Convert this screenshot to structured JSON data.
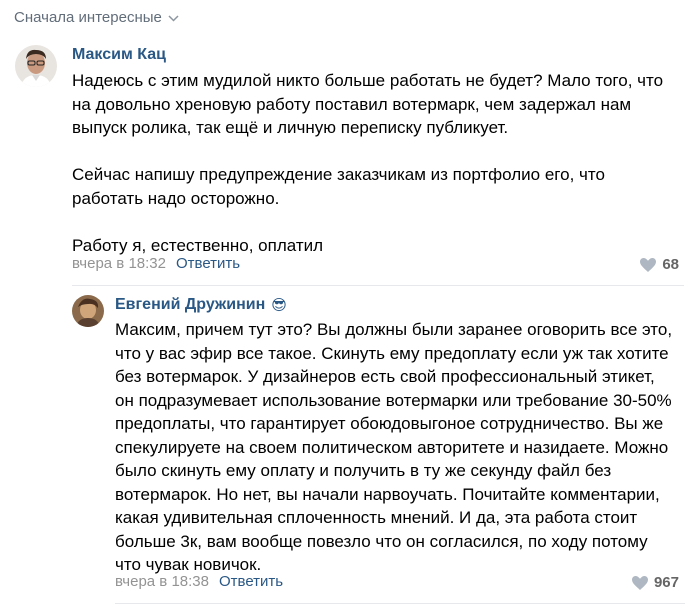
{
  "sort": {
    "label": "Сначала интересные"
  },
  "comments": [
    {
      "author": "Максим Кац",
      "text": "Надеюсь с этим мудилой никто больше работать не будет? Мало того, что\nна довольно хреновую работу поставил вотермарк, чем задержал нам\nвыпуск ролика, так ещё и личную переписку публикует.\n\nСейчас напишу предупреждение заказчикам из портфолио его, что\nработать надо осторожно.\n\nРаботу я, естественно, оплатил",
      "time": "вчера в 18:32",
      "reply": "Ответить",
      "likes": "68"
    },
    {
      "author": "Евгений Дружинин",
      "emoji": "😎",
      "text": "Максим, причем тут это? Вы должны были заранее оговорить все это,\nчто у вас эфир все такое. Скинуть ему предоплату если уж так хотите\nбез вотермарок. У дизайнеров есть свой профессиональный этикет,\nон подразумевает использование вотермарки или требование 30-50%\nпредоплаты, что гарантирует обоюдовыгоное сотрудничество. Вы же\nспекулируете на своем политическом авторитете и назидаете. Можно\nбыло скинуть ему оплату и получить в ту же секунду файл без\nвотермарок. Но нет, вы начали нарвоучать. Почитайте комментарии,\nкакая удивительная сплоченность мнений. И да, эта работа стоит\nбольше 3к, вам вообще повезло что он согласился, по ходу потому\nчто чувак новичок.",
      "time": "вчера в 18:38",
      "reply": "Ответить",
      "likes": "967"
    }
  ],
  "colors": {
    "link": "#2a5885",
    "muted": "#939393",
    "divider": "#e7e8ec"
  }
}
